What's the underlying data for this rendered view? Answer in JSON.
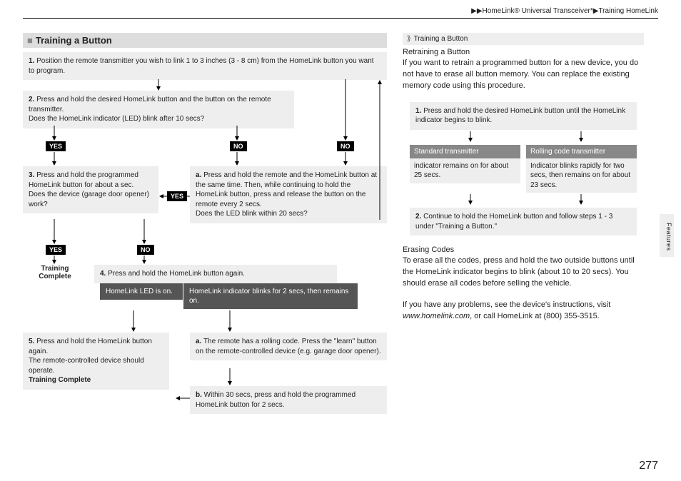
{
  "breadcrumb": {
    "prefix": "▶▶",
    "seg1": "HomeLink® Universal Transceiver*",
    "sep": "▶",
    "seg2": "Training HomeLink"
  },
  "left": {
    "heading": "Training a Button",
    "step1": "Position the remote transmitter you wish to link 1 to 3 inches (3 - 8 cm) from the HomeLink button you want to program.",
    "step1_num": "1.",
    "step2_num": "2.",
    "step2_a": "Press and hold the desired HomeLink button and the button on the remote transmitter.",
    "step2_b": "Does the HomeLink indicator (LED) blink after 10 secs?",
    "yes1": "YES",
    "no1": "NO",
    "no1b": "NO",
    "step3_num": "3.",
    "step3_a": "Press and hold the programmed HomeLink button for about a sec.",
    "step3_b": "Does the device (garage door opener) work?",
    "stepa_num": "a.",
    "stepa": "Press and hold the remote and the HomeLink button at the same time. Then, while continuing to hold the HomeLink button, press and release the button on the remote every 2 secs.",
    "stepa_q": "Does the LED blink within 20 secs?",
    "yes_mid": "YES",
    "yes2": "YES",
    "no2": "NO",
    "tc1": "Training Complete",
    "step4_num": "4.",
    "step4": "Press and hold the HomeLink button again.",
    "led_on": "HomeLink LED is on.",
    "led_blink": "HomeLink indicator blinks for 2 secs, then remains on.",
    "step5_num": "5.",
    "step5_a": "Press and hold the HomeLink button again.",
    "step5_b": "The remote-controlled device should operate.",
    "step5_tc": "Training Complete",
    "rolla_num": "a.",
    "rolla": "The remote has a rolling code. Press the \"learn\" button on the remote-controlled device (e.g. garage door opener).",
    "rollb_num": "b.",
    "rollb": "Within 30 secs, press and hold the programmed HomeLink button for 2 secs."
  },
  "right": {
    "head": "Training a Button",
    "retrain_h": "Retraining a Button",
    "retrain_p": "If you want to retrain a programmed button for a new device, you do not have to erase all button memory. You can replace the existing memory code using this procedure.",
    "r1_num": "1.",
    "r1": "Press and hold the desired HomeLink button until the HomeLink indicator begins to blink.",
    "std_h": "Standard transmitter",
    "std_p": "indicator remains on for about 25 secs.",
    "roll_h": "Rolling code transmitter",
    "roll_p": "Indicator blinks rapidly for two secs, then remains on for about 23 secs.",
    "r2_num": "2.",
    "r2": "Continue to hold the HomeLink button and follow steps 1 - 3 under \"Training a Button.\"",
    "erase_h": "Erasing Codes",
    "erase_p": "To erase all the codes, press and hold the two outside buttons until the HomeLink indicator begins to blink (about 10 to 20 secs). You should erase all codes before selling the vehicle.",
    "help_a": "If you have any problems, see the device's instructions, visit ",
    "help_url": "www.homelink.com",
    "help_b": ", or call HomeLink at (800) 355-3515."
  },
  "side_label": "Features",
  "page_number": "277"
}
